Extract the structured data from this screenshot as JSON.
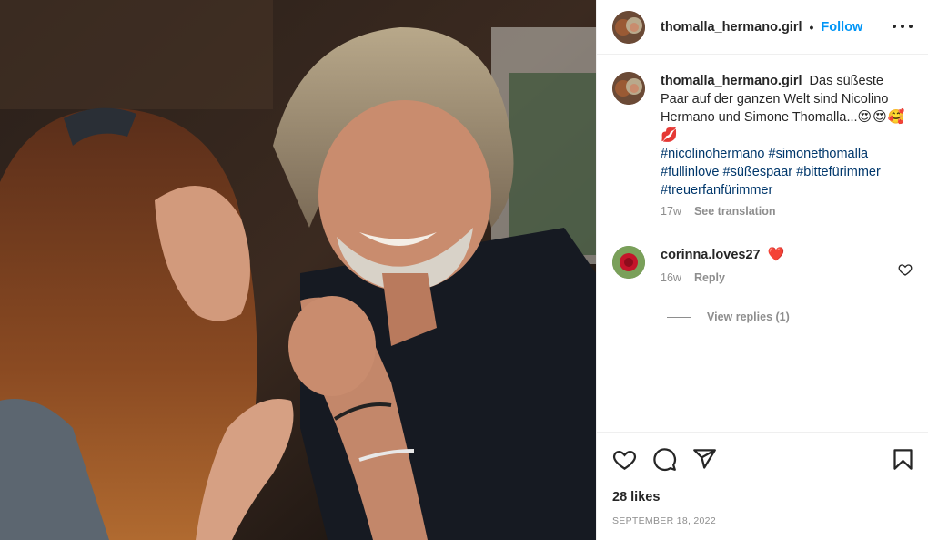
{
  "post": {
    "photo_icon": "couple-photo",
    "author": {
      "username": "thomalla_hermano.girl",
      "separator": "•",
      "follow_label": "Follow",
      "avatar_icon": "profile-avatar"
    },
    "more_icon": "more-options-icon",
    "caption": {
      "username": "thomalla_hermano.girl",
      "text": "Das süßeste Paar auf der ganzen Welt sind Nicolino Hermano und Simone Thomalla...",
      "emojis": "😍😍🥰💋",
      "hashtags": [
        "#nicolinohermano",
        "#simonethomalla",
        "#fullinlove",
        "#süßespaar",
        "#bittefürimmer",
        "#treuerfanfürimmer"
      ],
      "age": "17w",
      "see_translation": "See translation"
    },
    "comments": [
      {
        "username": "corinna.loves27",
        "text": "❤️",
        "age": "16w",
        "reply_label": "Reply",
        "view_replies_label": "View replies (1)",
        "avatar_icon": "rose-avatar",
        "like_icon": "heart-outline-icon"
      }
    ],
    "actions": {
      "like_icon": "heart-outline-icon",
      "comment_icon": "comment-bubble-icon",
      "share_icon": "paper-plane-icon",
      "save_icon": "bookmark-icon"
    },
    "likes": "28 likes",
    "date": "September 18, 2022",
    "colors": {
      "follow": "#0095f6",
      "hashtag": "#00376b",
      "muted": "#8e8e8e",
      "heart": "#ed4956"
    }
  }
}
